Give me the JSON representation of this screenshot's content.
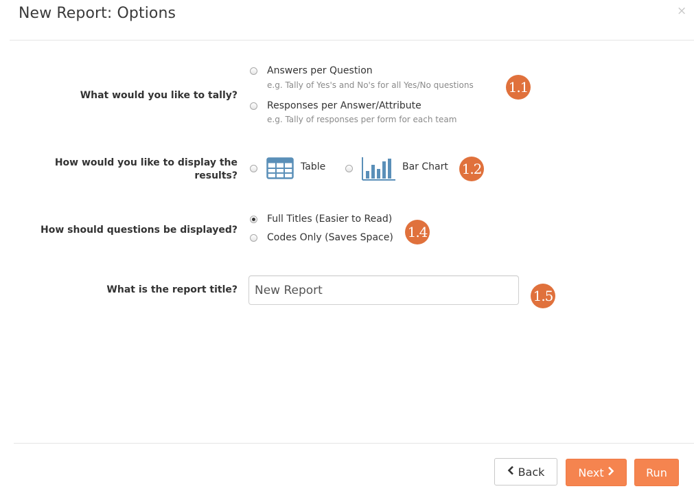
{
  "modal": {
    "title": "New Report: Options",
    "close_symbol": "×"
  },
  "tally": {
    "question": "What would you like to tally?",
    "options": [
      {
        "label": "Answers per Question",
        "hint": "e.g. Tally of Yes's and No's for all Yes/No questions",
        "checked": false
      },
      {
        "label": "Responses per Answer/Attribute",
        "hint": "e.g. Tally of responses per form for each team",
        "checked": false
      }
    ],
    "badge": "1.1"
  },
  "display": {
    "question_line1": "How would you like to display the",
    "question_line2": "results?",
    "options": [
      {
        "label": "Table",
        "icon": "table-icon",
        "checked": false
      },
      {
        "label": "Bar Chart",
        "icon": "bar-chart-icon",
        "checked": false
      }
    ],
    "badge": "1.2"
  },
  "questions_display": {
    "question": "How should questions be displayed?",
    "options": [
      {
        "label": "Full Titles (Easier to Read)",
        "checked": true
      },
      {
        "label": "Codes Only (Saves Space)",
        "checked": false
      }
    ],
    "badge": "1.4"
  },
  "report_title": {
    "question": "What is the report title?",
    "value": "New Report",
    "badge": "1.5"
  },
  "footer": {
    "back_label": "Back",
    "next_label": "Next",
    "run_label": "Run"
  },
  "colors": {
    "accent": "#f5844f",
    "badge": "#e0713c",
    "icon_blue": "#5a8fb8"
  }
}
